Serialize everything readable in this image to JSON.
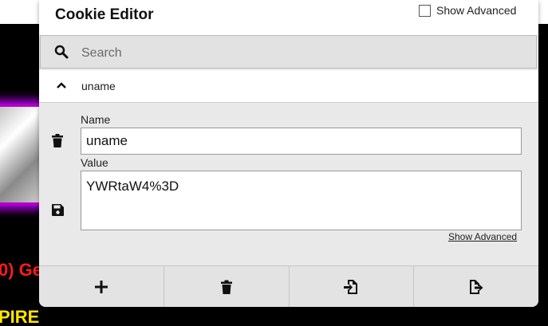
{
  "popup": {
    "title": "Cookie Editor",
    "show_advanced_label": "Show Advanced"
  },
  "search": {
    "placeholder": "Search",
    "value": ""
  },
  "cookie": {
    "name": "uname",
    "name_label": "Name",
    "name_value": "uname",
    "value_label": "Value",
    "value_value": "YWRtaW4%3D",
    "show_advanced_link": "Show Advanced"
  },
  "toolbar": {
    "buttons": [
      {
        "icon": "plus-icon"
      },
      {
        "icon": "trash-icon"
      },
      {
        "icon": "import-icon"
      },
      {
        "icon": "export-icon"
      }
    ]
  },
  "background_page": {
    "red_text": "0) Ge",
    "yellow_text": "PIRE"
  },
  "colors": {
    "background_page": "#000000",
    "panel": "#e9e9e9",
    "logo_glow": "#c000ff",
    "red_text": "#ff1a1a",
    "yellow_text": "#ffe600"
  }
}
